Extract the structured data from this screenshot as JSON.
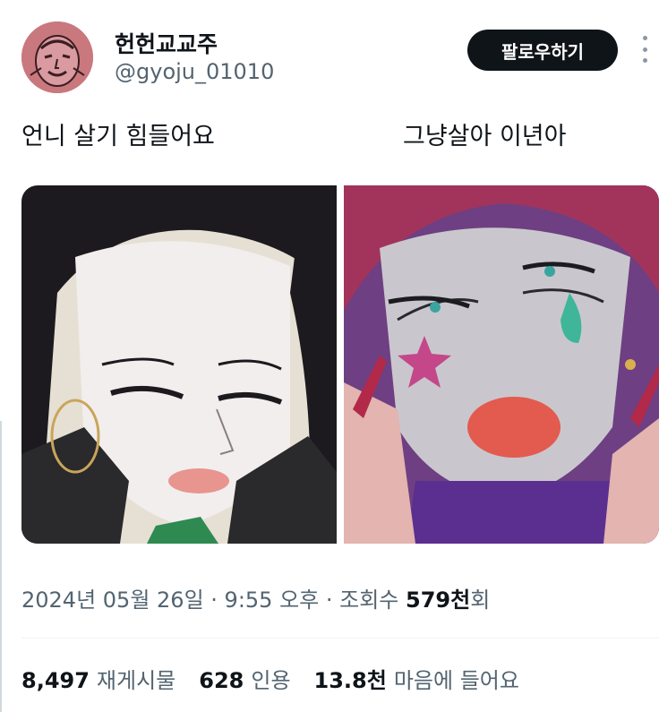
{
  "user": {
    "display_name": "헌헌교교주",
    "handle": "@gyoju_01010",
    "avatar_icon": "avatar-illustration"
  },
  "actions": {
    "follow_label": "팔로우하기",
    "more_icon": "more-vertical-icon"
  },
  "tweet": {
    "caption_left": "언니 살기 힘들어요",
    "caption_right": "그냥살아 이년아",
    "media": [
      {
        "name": "anime-character-illumi",
        "alt_icon": "image-icon"
      },
      {
        "name": "anime-character-hisoka",
        "alt_icon": "image-icon"
      }
    ]
  },
  "meta": {
    "date": "2024년 05월 26일",
    "sep1": " · ",
    "time": "9:55 오후",
    "sep2": " · ",
    "views_label": "조회수 ",
    "views_count": "579천",
    "views_suffix": "회"
  },
  "stats": {
    "retweets_count": "8,497",
    "retweets_label": "재게시물",
    "quotes_count": "628",
    "quotes_label": "인용",
    "likes_count": "13.8천",
    "likes_label": "마음에 들어요"
  },
  "colors": {
    "text_primary": "#0f1419",
    "text_secondary": "#536471",
    "button_bg": "#0f1419",
    "divider": "#eff3f4"
  }
}
